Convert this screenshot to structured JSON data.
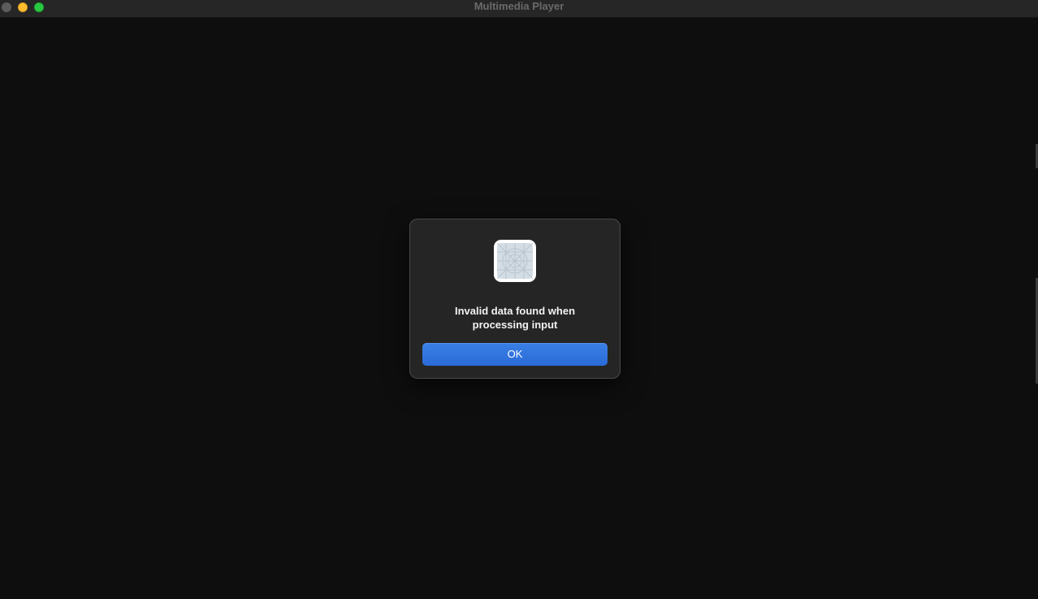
{
  "window": {
    "title": "Multimedia Player",
    "controls": {
      "close_icon": "close-icon",
      "minimize_icon": "minimize-icon",
      "zoom_icon": "zoom-icon"
    }
  },
  "dialog": {
    "icon": "generic-app-icon",
    "message_line1": "Invalid data found when",
    "message_line2": "processing input",
    "ok_label": "OK",
    "accent_color": "#2f74e0"
  }
}
